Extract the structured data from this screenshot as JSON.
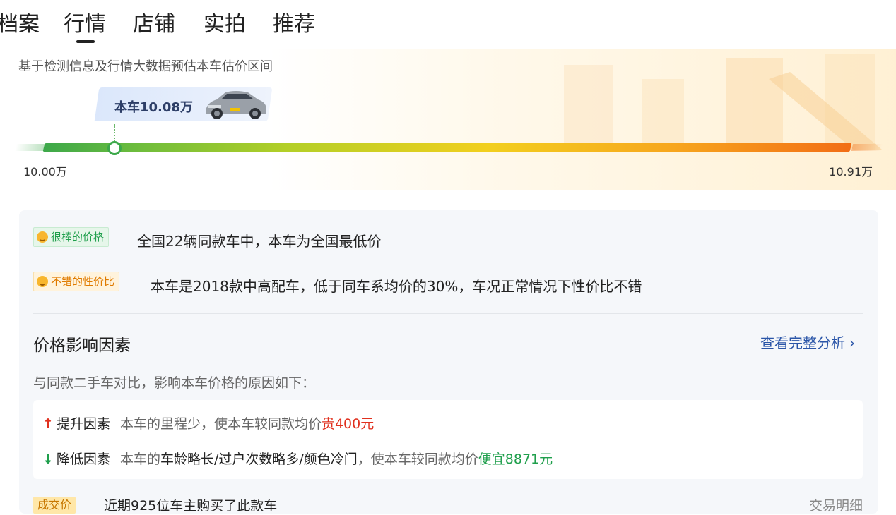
{
  "tabs": [
    {
      "label": "档案"
    },
    {
      "label": "行情",
      "active": true
    },
    {
      "label": "店铺"
    },
    {
      "label": "实拍"
    },
    {
      "label": "推荐"
    }
  ],
  "hero": {
    "subtitle": "基于检测信息及行情大数据预估本车估价区间",
    "current_price_label": "本车10.08万",
    "range_min": "10.00万",
    "range_max": "10.91万",
    "current_value_wan": 10.08,
    "min_value_wan": 10.0,
    "max_value_wan": 10.91
  },
  "highlights": [
    {
      "tag": "很棒的价格",
      "text": "全国22辆同款车中，本车为全国最低价",
      "color": "#1f9f4c",
      "icon": "smile-icon"
    },
    {
      "tag": "不错的性价比",
      "text": "本车是2018款中高配车，低于同车系均价的30%，车况正常情况下性价比不错",
      "color": "#e07b00",
      "icon": "smile-icon"
    }
  ],
  "factors_section": {
    "title": "价格影响因素",
    "link": "查看完整分析",
    "description": "与同款二手车对比，影响本车价格的原因如下："
  },
  "factors": {
    "up": {
      "arrow": "↑",
      "label": "提升因素",
      "prefix": "本车的里程少，使本车较同款均价",
      "amount_text": "贵400元"
    },
    "down": {
      "arrow": "↓",
      "label": "降低因素",
      "prefix": "本车的",
      "highlight": "车龄略长/过户次数略多/颜色冷门",
      "middle": "，使本车较同款均价",
      "amount_text": "便宜8871元"
    }
  },
  "deal_row": {
    "tag": "成交价",
    "text": "近期925位车主购买了此款车",
    "link": "交易明细"
  },
  "colors": {
    "accent_blue": "#2a55a8",
    "up_red": "#e0301e",
    "down_green": "#1f9f4c"
  }
}
